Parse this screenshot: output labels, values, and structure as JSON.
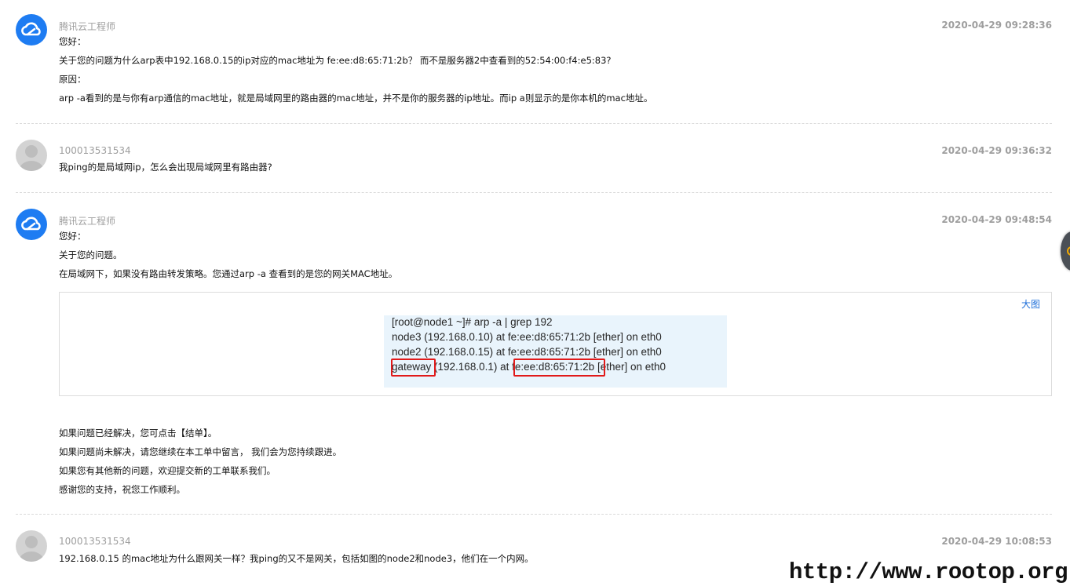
{
  "messages": [
    {
      "sender": "腾讯云工程师",
      "time": "2020-04-29 09:28:36",
      "lines": [
        "您好：",
        "关于您的问题为什么arp表中192.168.0.15的ip对应的mac地址为 fe:ee:d8:65:71:2b？ 而不是服务器2中查看到的52:54:00:f4:e5:83?",
        "原因：",
        "arp -a看到的是与你有arp通信的mac地址，就是局域网里的路由器的mac地址，并不是你的服务器的ip地址。而ip a则显示的是你本机的mac地址。"
      ]
    },
    {
      "sender": "100013531534",
      "time": "2020-04-29 09:36:32",
      "lines": [
        "我ping的是局域网ip，怎么会出现局域网里有路由器?"
      ]
    },
    {
      "sender": "腾讯云工程师",
      "time": "2020-04-29 09:48:54",
      "lines": [
        "您好：",
        "关于您的问题。",
        "在局域网下，如果没有路由转发策略。您通过arp -a 查看到的是您的网关MAC地址。"
      ],
      "image": {
        "enlarge_label": "大图",
        "terminal_lines": [
          "[root@node1 ~]# arp -a | grep 192",
          "node3 (192.168.0.10) at fe:ee:d8:65:71:2b [ether] on eth0",
          "node2 (192.168.0.15) at fe:ee:d8:65:71:2b [ether] on eth0",
          "gateway (192.168.0.1) at fe:ee:d8:65:71:2b [ether] on eth0"
        ]
      },
      "footer_lines": [
        "如果问题已经解决，您可点击【结单】。",
        "如果问题尚未解决，请您继续在本工单中留言， 我们会为您持续跟进。",
        "如果您有其他新的问题，欢迎提交新的工单联系我们。",
        "感谢您的支持，祝您工作顺利。"
      ]
    },
    {
      "sender": "100013531534",
      "time": "2020-04-29 10:08:53",
      "lines": [
        "192.168.0.15 的mac地址为什么跟网关一样？我ping的又不是网关，包括如图的node2和node3，他们在一个内网。"
      ]
    }
  ],
  "icons": {
    "engineer_avatar": "tencent-cloud-logo-icon",
    "user_avatar": "default-user-icon"
  },
  "colors": {
    "engineer_avatar_bg": "#1e7cf2",
    "user_avatar_bg": "#d3d3d3",
    "highlight_border": "#e11a1a",
    "terminal_bg": "#e9f4fc",
    "link": "#1e6fd9"
  },
  "watermark": "http://www.rootop.org"
}
